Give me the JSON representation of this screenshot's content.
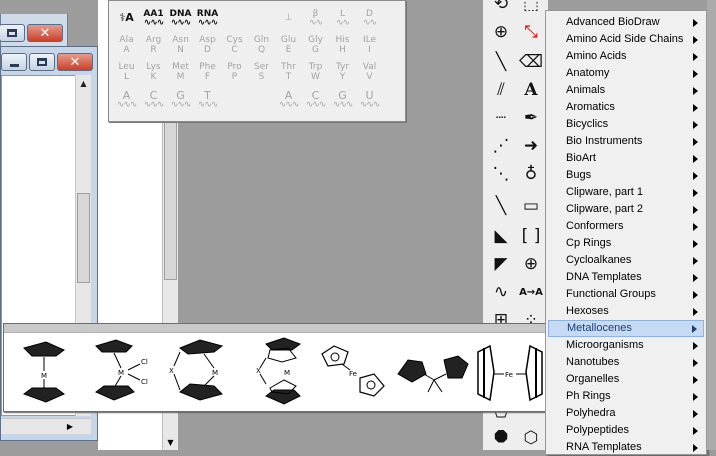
{
  "bio_palette": {
    "headers": [
      "AA1",
      "DNA",
      "RNA"
    ],
    "amino_acids": [
      {
        "name": "Ala",
        "code": "A"
      },
      {
        "name": "Arg",
        "code": "R"
      },
      {
        "name": "Asn",
        "code": "N"
      },
      {
        "name": "Asp",
        "code": "D"
      },
      {
        "name": "Cys",
        "code": "C"
      },
      {
        "name": "Gln",
        "code": "Q"
      },
      {
        "name": "Glu",
        "code": "E"
      },
      {
        "name": "Gly",
        "code": "G"
      },
      {
        "name": "His",
        "code": "H"
      },
      {
        "name": "ILe",
        "code": "I"
      },
      {
        "name": "Leu",
        "code": "L"
      },
      {
        "name": "Lys",
        "code": "K"
      },
      {
        "name": "Met",
        "code": "M"
      },
      {
        "name": "Phe",
        "code": "F"
      },
      {
        "name": "Pro",
        "code": "P"
      },
      {
        "name": "Ser",
        "code": "S"
      },
      {
        "name": "Thr",
        "code": "T"
      },
      {
        "name": "Trp",
        "code": "W"
      },
      {
        "name": "Tyr",
        "code": "Y"
      },
      {
        "name": "Val",
        "code": "V"
      }
    ],
    "dna_bases": [
      "A",
      "C",
      "G",
      "T"
    ],
    "rna_bases": [
      "A",
      "C",
      "G",
      "U"
    ],
    "strand_labels": [
      "β",
      "L",
      "D"
    ]
  },
  "metallocene_templates": {
    "labels": [
      "M",
      "M",
      "Cl",
      "Cl",
      "X",
      "M",
      "X",
      "M",
      "Fe",
      "Fe"
    ]
  },
  "menu": {
    "items": [
      "Advanced BioDraw",
      "Amino Acid Side Chains",
      "Amino Acids",
      "Anatomy",
      "Animals",
      "Aromatics",
      "Bicyclics",
      "Bio Instruments",
      "BioArt",
      "Bugs",
      "Clipware, part 1",
      "Clipware, part 2",
      "Conformers",
      "Cp Rings",
      "Cycloalkanes",
      "DNA Templates",
      "Functional Groups",
      "Hexoses",
      "Metallocenes",
      "Microorganisms",
      "Nanotubes",
      "Organelles",
      "Ph Rings",
      "Polyhedra",
      "Polypeptides",
      "RNA Templates"
    ],
    "active_index": 18,
    "highlight_color": "#c6daf4"
  },
  "toolbar": {
    "text_tool_label": "A",
    "atom_map_label": "A→A",
    "bracket_label": "[ ]"
  },
  "theme": {
    "desktop_gray": "#9c9c9c",
    "close_button_red": "#c8402a",
    "window_frame_blue": "#c6d6e8"
  }
}
